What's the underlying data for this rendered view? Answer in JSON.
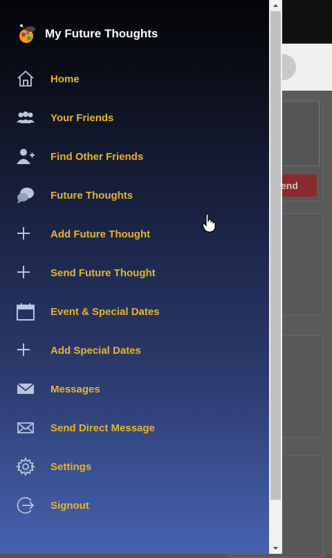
{
  "app": {
    "title": "My Future Thoughts"
  },
  "background": {
    "send_label": "end"
  },
  "menu": {
    "items": [
      {
        "label": "Home",
        "icon": "home-icon"
      },
      {
        "label": "Your Friends",
        "icon": "friends-icon"
      },
      {
        "label": "Find Other Friends",
        "icon": "add-user-icon"
      },
      {
        "label": "Future Thoughts",
        "icon": "chat-bubbles-icon"
      },
      {
        "label": "Add Future Thought",
        "icon": "plus-icon"
      },
      {
        "label": "Send Future Thought",
        "icon": "plus-icon"
      },
      {
        "label": "Event & Special Dates",
        "icon": "calendar-icon"
      },
      {
        "label": "Add Special Dates",
        "icon": "plus-icon"
      },
      {
        "label": "Messages",
        "icon": "envelope-filled-icon"
      },
      {
        "label": "Send Direct Message",
        "icon": "envelope-outline-icon"
      },
      {
        "label": "Settings",
        "icon": "gear-icon"
      },
      {
        "label": "Signout",
        "icon": "signout-icon"
      }
    ]
  },
  "colors": {
    "accent": "#e6b52c",
    "icon": "#b8c6dc",
    "title": "#ffffff"
  }
}
